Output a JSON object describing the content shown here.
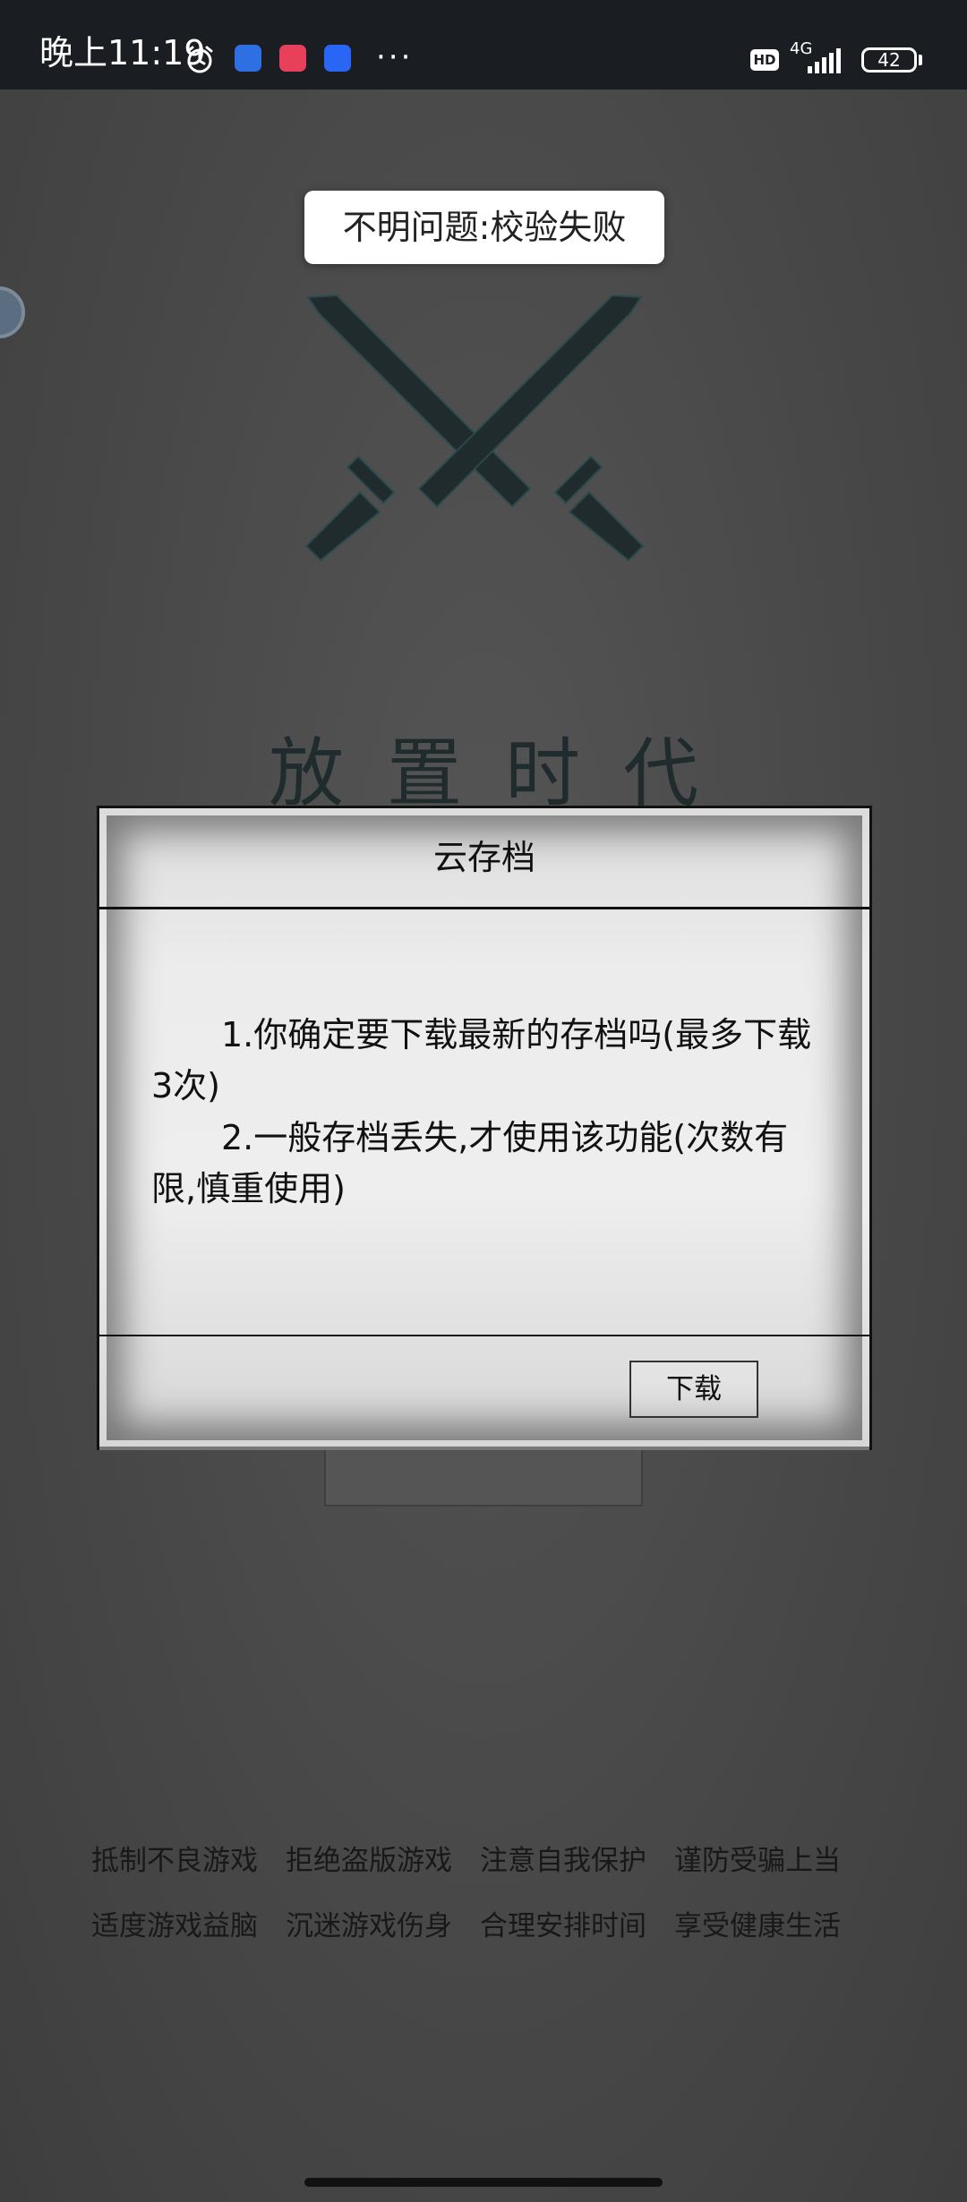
{
  "status_bar": {
    "time": "晚上11:19",
    "network": "4G",
    "battery": "42",
    "icons": [
      "alarm-icon",
      "baidu-app-icon",
      "red-app-icon",
      "blue-app-icon",
      "more-icon",
      "hd-icon",
      "signal-icon",
      "battery-icon"
    ]
  },
  "toast": {
    "text": "不明问题:校验失败"
  },
  "game": {
    "title": "放置时代",
    "logo": "crossed-swords-icon",
    "slogans": [
      [
        "抵制不良游戏",
        "拒绝盗版游戏",
        "注意自我保护",
        "谨防受骗上当"
      ],
      [
        "适度游戏益脑",
        "沉迷游戏伤身",
        "合理安排时间",
        "享受健康生活"
      ]
    ]
  },
  "dialog": {
    "title": "云存档",
    "lines": [
      "1.你确定要下载最新的存档吗(最多下载3次)",
      "2.一般存档丢失,才使用该功能(次数有限,慎重使用)"
    ],
    "download_label": "下载"
  }
}
